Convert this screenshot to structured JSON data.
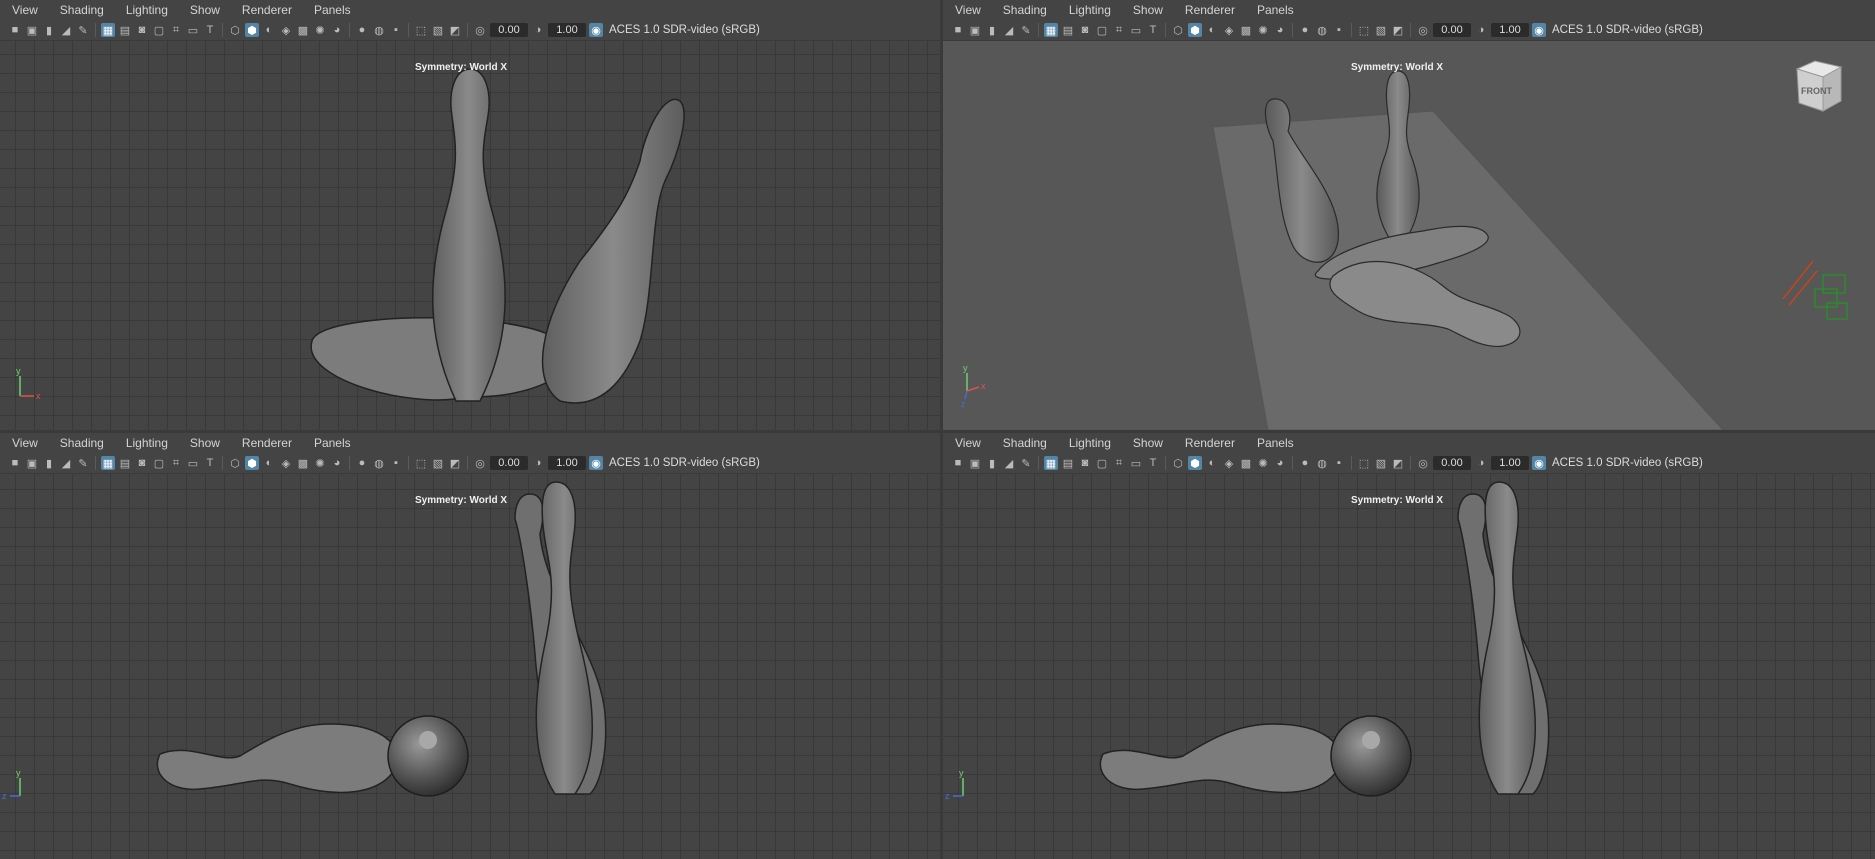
{
  "menus": [
    "View",
    "Shading",
    "Lighting",
    "Show",
    "Renderer",
    "Panels"
  ],
  "toolbar": {
    "exposure": "0.00",
    "gamma": "1.00",
    "colorspace": "ACES 1.0 SDR-video (sRGB)"
  },
  "symmetry_label": "Symmetry: World X",
  "viewcube_label": "FRONT",
  "axis_labels": {
    "x": "x",
    "y": "y",
    "z": "z"
  },
  "colors": {
    "grid_bg": "#444444",
    "grid_line": "#2e2e2e",
    "toolbar_active": "#5285a6",
    "mesh_fill": "#7a7a7a"
  }
}
